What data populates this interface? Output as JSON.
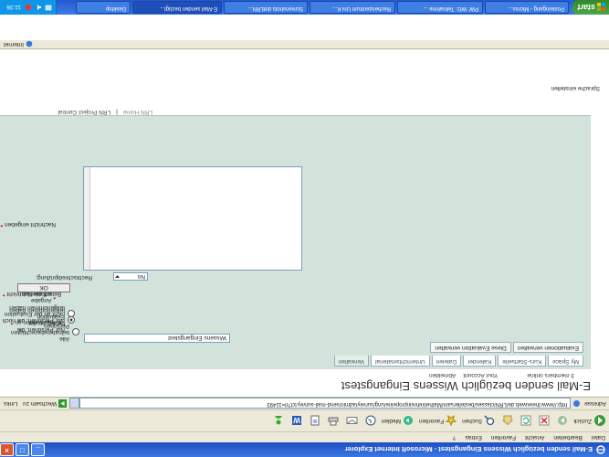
{
  "window": {
    "title": "E-Mail senden bezüglich Wissens Eingangstest - Microsoft Internet Explorer"
  },
  "menu": [
    "Datei",
    "Bearbeiten",
    "Ansicht",
    "Favoriten",
    "Extras",
    "?"
  ],
  "toolbar": {
    "back": "Zurück",
    "search": "Suchen",
    "favorites": "Favoriten",
    "media": "Medien"
  },
  "address": {
    "label": "Adresse",
    "url": "http://www.thewuweb.de/LRN/classes/bestellersam/Matheti/ehreinpropeine/ung/survey/admin/send-mail-survey.tcl?rl=11493",
    "go_label": "Wechseln zu",
    "links_label": "Links"
  },
  "page": {
    "title": "E-Mail senden bezüglich Wissens Eingangstest",
    "members_online": "3 members online",
    "your_account": "Your Account",
    "logout": "Abmelden",
    "tabs": [
      "My Space",
      "Kurs-Startseite",
      "Kalender",
      "Dateien",
      "Unterrichtsmaterial",
      "Verwalten"
    ],
    "subtabs": [
      "Evaluationen verwalten",
      "Diese Evaluation verwalten"
    ],
    "send_to_label": "E-Mail senden an",
    "radio_options": [
      "Alle teilnahmeberechtigten Personen",
      "Nur Personen, die bereits an der Evaluation teilgenommen haben",
      "Nur Personen, die noch nicht an der Evaluation teilgenommen haben"
    ],
    "subject_label": "Betreff der Nachricht",
    "subject_value": "Wissens Eingangstest",
    "message_label": "Nachricht eingeben",
    "spellcheck_label": "Rechtschreibprüfung:",
    "spellcheck_value": "No",
    "ok_label": "OK",
    "required_note": "Angabe erforderlich",
    "footer_links": [
      "LRN Home",
      "LRN Project Central"
    ],
    "language_link": "Sprache einstellen"
  },
  "statusbar": {
    "zone": "Internet"
  },
  "taskbar": {
    "start": "start",
    "tasks": [
      "Posteingang - Micros...",
      "PW: WG: Teilnahme ...",
      "Rechenzentrum Uni K...",
      "Screenshots dotLRN...",
      "E-Mail senden bezügl...",
      "Desktop"
    ],
    "clock": "11:26"
  },
  "colors": {
    "content_bg": "#d2e3dc",
    "required": "#c0001a",
    "titlebar": "#1e4fc4"
  }
}
